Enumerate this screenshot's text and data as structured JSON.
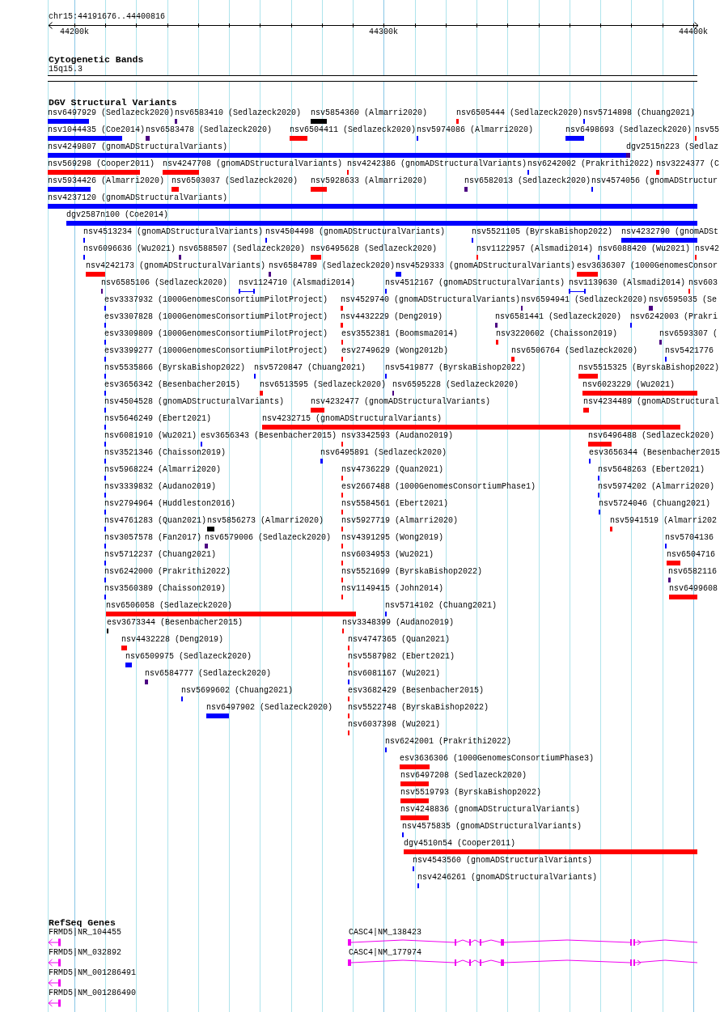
{
  "ruler": {
    "region": "chr15:44191676..44400816",
    "ticks": [
      "44200k",
      "44300k",
      "44400k"
    ]
  },
  "bands": {
    "title": "Cytogenetic Bands",
    "features": [
      {
        "label": "15q15.3"
      }
    ]
  },
  "variants": {
    "title": "DGV Structural Variants",
    "rows": [
      {
        "features": [
          {
            "label": "nsv6497929 (Sedlazeck2020)",
            "kind": "bar",
            "color": "#0000ff"
          },
          {
            "label": "nsv6583410 (Sedlazeck2020)",
            "kind": "bar",
            "color": "#4b0082"
          },
          {
            "label": "nsv5854360 (Almarri2020)",
            "kind": "bar",
            "color": "#000000"
          },
          {
            "label": "nsv6505444 (Sedlazeck2020)",
            "kind": "bar",
            "color": "#ff0000"
          },
          {
            "label": "nsv5714898 (Chuang2021)",
            "kind": "bar",
            "color": "#0000ff"
          }
        ]
      },
      {
        "features": [
          {
            "label": "nsv1044435 (Coe2014)",
            "kind": "bar",
            "color": "#0000ff"
          },
          {
            "label": "nsv6583478 (Sedlazeck2020)",
            "kind": "bar",
            "color": "#4b0082"
          },
          {
            "label": "nsv6504411 (Sedlazeck2020)",
            "kind": "bar",
            "color": "#ff0000"
          },
          {
            "label": "nsv5974086 (Almarri2020)",
            "kind": "bar",
            "color": "#0000ff"
          },
          {
            "label": "nsv6498693 (Sedlazeck2020)",
            "kind": "bar",
            "color": "#0000ff"
          },
          {
            "label": "nsv55",
            "kind": "bar",
            "color": "#ff0000"
          }
        ]
      },
      {
        "features": [
          {
            "label": "nsv4249807 (gnomADStructuralVariants)",
            "kind": "bar",
            "color": "#0000ff"
          },
          {
            "label": "dgv2515n223 (Sedlaz",
            "kind": "bar",
            "color": "#4b0082"
          }
        ]
      },
      {
        "features": [
          {
            "label": "nsv569298 (Cooper2011)",
            "kind": "bar",
            "color": "#ff0000"
          },
          {
            "label": "nsv4247708 (gnomADStructuralVariants)",
            "kind": "bar",
            "color": "#ff0000"
          },
          {
            "label": "nsv4242386 (gnomADStructuralVariants)",
            "kind": "bar",
            "color": "#ff0000"
          },
          {
            "label": "nsv6242002 (Prakrithi2022)",
            "kind": "bar",
            "color": "#0000ff"
          },
          {
            "label": "nsv3224377 (C",
            "kind": "bar",
            "color": "#ff0000"
          }
        ]
      },
      {
        "features": [
          {
            "label": "nsv5934426 (Almarri2020)",
            "kind": "bar",
            "color": "#0000ff"
          },
          {
            "label": "nsv6503037 (Sedlazeck2020)",
            "kind": "bar",
            "color": "#ff0000"
          },
          {
            "label": "nsv5928633 (Almarri2020)",
            "kind": "bar",
            "color": "#ff0000"
          },
          {
            "label": "nsv6582013 (Sedlazeck2020)",
            "kind": "bar",
            "color": "#4b0082"
          },
          {
            "label": "nsv4574056 (gnomADStructur",
            "kind": "bar",
            "color": "#0000ff"
          }
        ]
      },
      {
        "features": [
          {
            "label": "nsv4237120 (gnomADStructuralVariants)",
            "kind": "bar",
            "color": "#0000ff"
          }
        ]
      },
      {
        "features": [
          {
            "label": "dgv2587n100 (Coe2014)",
            "kind": "bar",
            "color": "#0000ff"
          }
        ]
      },
      {
        "features": [
          {
            "label": "nsv4513234 (gnomADStructuralVariants)",
            "kind": "bar",
            "color": "#0000ff"
          },
          {
            "label": "nsv4504498 (gnomADStructuralVariants)",
            "kind": "bar",
            "color": "#0000ff"
          },
          {
            "label": "nsv5521105 (ByrskaBishop2022)",
            "kind": "bar",
            "color": "#0000ff"
          },
          {
            "label": "nsv4232790 (gnomADSt",
            "kind": "bar",
            "color": "#0000ff"
          }
        ]
      },
      {
        "features": [
          {
            "label": "nsv6096636 (Wu2021)",
            "kind": "bar",
            "color": "#0000ff"
          },
          {
            "label": "nsv6588507 (Sedlazeck2020)",
            "kind": "bar",
            "color": "#4b0082"
          },
          {
            "label": "nsv6495628 (Sedlazeck2020)",
            "kind": "bar",
            "color": "#ff0000"
          },
          {
            "label": "nsv1122957 (Alsmadi2014)",
            "kind": "bar",
            "color": "#ff0000"
          },
          {
            "label": "nsv6088420 (Wu2021)",
            "kind": "bar",
            "color": "#0000ff"
          },
          {
            "label": "nsv42",
            "kind": "bar",
            "color": "#ff0000"
          }
        ]
      },
      {
        "features": [
          {
            "label": "nsv4242173 (gnomADStructuralVariants)",
            "kind": "bar",
            "color": "#ff0000"
          },
          {
            "label": "nsv6584789 (Sedlazeck2020)",
            "kind": "bar",
            "color": "#4b0082"
          },
          {
            "label": "nsv4529333 (gnomADStructuralVariants)",
            "kind": "bar",
            "color": "#0000ff"
          },
          {
            "label": "esv3636307 (1000GenomesConsor",
            "kind": "bar",
            "color": "#ff0000"
          }
        ]
      },
      {
        "features": [
          {
            "label": "nsv6585106 (Sedlazeck2020)",
            "kind": "bar",
            "color": "#4b0082"
          },
          {
            "label": "nsv1124710 (Alsmadi2014)",
            "kind": "span",
            "color": "#0000ff"
          },
          {
            "label": "nsv4512167 (gnomADStructuralVariants)",
            "kind": "bar",
            "color": "#0000ff"
          },
          {
            "label": "nsv1139630 (Alsmadi2014)",
            "kind": "span",
            "color": "#0000ff"
          },
          {
            "label": "nsv603",
            "kind": "bar",
            "color": "#ff0000"
          }
        ]
      },
      {
        "features": [
          {
            "label": "esv3337932 (1000GenomesConsortiumPilotProject)",
            "kind": "bar",
            "color": "#0000ff"
          },
          {
            "label": "nsv4529740 (gnomADStructuralVariants)",
            "kind": "bar",
            "color": "#ff0000"
          },
          {
            "label": "nsv6594941 (Sedlazeck2020)",
            "kind": "bar",
            "color": "#4b0082"
          },
          {
            "label": "nsv6595035 (Se",
            "kind": "bar",
            "color": "#4b0082"
          }
        ]
      },
      {
        "features": [
          {
            "label": "esv3307828 (1000GenomesConsortiumPilotProject)",
            "kind": "bar",
            "color": "#0000ff"
          },
          {
            "label": "nsv4432229 (Deng2019)",
            "kind": "bar",
            "color": "#ff0000"
          },
          {
            "label": "nsv6581441 (Sedlazeck2020)",
            "kind": "bar",
            "color": "#4b0082"
          },
          {
            "label": "nsv6242003 (Prakri",
            "kind": "bar",
            "color": "#0000ff"
          }
        ]
      },
      {
        "features": [
          {
            "label": "esv3309809 (1000GenomesConsortiumPilotProject)",
            "kind": "bar",
            "color": "#0000ff"
          },
          {
            "label": "esv3552381 (Boomsma2014)",
            "kind": "bar",
            "color": "#ff0000"
          },
          {
            "label": "nsv3220602 (Chaisson2019)",
            "kind": "bar",
            "color": "#ff0000"
          },
          {
            "label": "nsv6593307 (",
            "kind": "bar",
            "color": "#4b0082"
          }
        ]
      },
      {
        "features": [
          {
            "label": "esv3399277 (1000GenomesConsortiumPilotProject)",
            "kind": "bar",
            "color": "#0000ff"
          },
          {
            "label": "esv2749629 (Wong2012b)",
            "kind": "bar",
            "color": "#ff0000"
          },
          {
            "label": "nsv6506764 (Sedlazeck2020)",
            "kind": "bar",
            "color": "#ff0000"
          },
          {
            "label": "nsv5421776",
            "kind": "bar",
            "color": "#0000ff"
          }
        ]
      },
      {
        "features": [
          {
            "label": "nsv5535866 (ByrskaBishop2022)",
            "kind": "bar",
            "color": "#0000ff"
          },
          {
            "label": "nsv5720847 (Chuang2021)",
            "kind": "bar",
            "color": "#0000ff"
          },
          {
            "label": "nsv5419877 (ByrskaBishop2022)",
            "kind": "bar",
            "color": "#0000ff"
          },
          {
            "label": "nsv5515325 (ByrskaBishop2022)",
            "kind": "bar",
            "color": "#ff0000"
          }
        ]
      },
      {
        "features": [
          {
            "label": "esv3656342 (Besenbacher2015)",
            "kind": "bar",
            "color": "#0000ff"
          },
          {
            "label": "nsv6513595 (Sedlazeck2020)",
            "kind": "bar",
            "color": "#ff0000"
          },
          {
            "label": "nsv6595228 (Sedlazeck2020)",
            "kind": "bar",
            "color": "#4b0082"
          },
          {
            "label": "nsv6023229 (Wu2021)",
            "kind": "bar",
            "color": "#ff0000"
          }
        ]
      },
      {
        "features": [
          {
            "label": "nsv4504528 (gnomADStructuralVariants)",
            "kind": "bar",
            "color": "#0000ff"
          },
          {
            "label": "nsv4232477 (gnomADStructuralVariants)",
            "kind": "bar",
            "color": "#ff0000"
          },
          {
            "label": "nsv4234489 (gnomADStructural",
            "kind": "bar",
            "color": "#ff0000"
          }
        ]
      },
      {
        "features": [
          {
            "label": "nsv5646249 (Ebert2021)",
            "kind": "bar",
            "color": "#0000ff"
          },
          {
            "label": "nsv4232715 (gnomADStructuralVariants)",
            "kind": "bar",
            "color": "#ff0000"
          }
        ]
      },
      {
        "features": [
          {
            "label": "nsv6081910 (Wu2021)",
            "kind": "bar",
            "color": "#0000ff"
          },
          {
            "label": "esv3656343 (Besenbacher2015)",
            "kind": "bar",
            "color": "#0000ff"
          },
          {
            "label": "nsv3342593 (Audano2019)",
            "kind": "bar",
            "color": "#ff0000"
          },
          {
            "label": "nsv6496488 (Sedlazeck2020)",
            "kind": "bar",
            "color": "#ff0000"
          }
        ]
      },
      {
        "features": [
          {
            "label": "nsv3521346 (Chaisson2019)",
            "kind": "bar",
            "color": "#0000ff"
          },
          {
            "label": "nsv6495891 (Sedlazeck2020)",
            "kind": "bar",
            "color": "#0000ff"
          },
          {
            "label": "esv3656344 (Besenbacher2015",
            "kind": "bar",
            "color": "#0000ff"
          }
        ]
      },
      {
        "features": [
          {
            "label": "nsv5968224 (Almarri2020)",
            "kind": "bar",
            "color": "#0000ff"
          },
          {
            "label": "nsv4736229 (Quan2021)",
            "kind": "bar",
            "color": "#ff0000"
          },
          {
            "label": "nsv5648263 (Ebert2021)",
            "kind": "bar",
            "color": "#0000ff"
          }
        ]
      },
      {
        "features": [
          {
            "label": "nsv3339832 (Audano2019)",
            "kind": "bar",
            "color": "#0000ff"
          },
          {
            "label": "esv2667488 (1000GenomesConsortiumPhase1)",
            "kind": "bar",
            "color": "#ff0000"
          },
          {
            "label": "nsv5974202 (Almarri2020)",
            "kind": "bar",
            "color": "#0000ff"
          }
        ]
      },
      {
        "features": [
          {
            "label": "nsv2794964 (Huddleston2016)",
            "kind": "bar",
            "color": "#0000ff"
          },
          {
            "label": "nsv5584561 (Ebert2021)",
            "kind": "bar",
            "color": "#ff0000"
          },
          {
            "label": "nsv5724046 (Chuang2021)",
            "kind": "bar",
            "color": "#0000ff"
          }
        ]
      },
      {
        "features": [
          {
            "label": "nsv4761283 (Quan2021)",
            "kind": "bar",
            "color": "#0000ff"
          },
          {
            "label": "nsv5856273 (Almarri2020)",
            "kind": "bar",
            "color": "#000000"
          },
          {
            "label": "nsv5927719 (Almarri2020)",
            "kind": "bar",
            "color": "#ff0000"
          },
          {
            "label": "nsv5941519 (Almarri202",
            "kind": "bar",
            "color": "#ff0000"
          }
        ]
      },
      {
        "features": [
          {
            "label": "nsv3057578 (Fan2017)",
            "kind": "bar",
            "color": "#0000ff"
          },
          {
            "label": "nsv6579006 (Sedlazeck2020)",
            "kind": "bar",
            "color": "#4b0082"
          },
          {
            "label": "nsv4391295 (Wong2019)",
            "kind": "bar",
            "color": "#ff0000"
          },
          {
            "label": "nsv5704136",
            "kind": "bar",
            "color": "#0000ff"
          }
        ]
      },
      {
        "features": [
          {
            "label": "nsv5712237 (Chuang2021)",
            "kind": "bar",
            "color": "#0000ff"
          },
          {
            "label": "nsv6034953 (Wu2021)",
            "kind": "bar",
            "color": "#ff0000"
          },
          {
            "label": "nsv6504716",
            "kind": "bar",
            "color": "#ff0000"
          }
        ]
      },
      {
        "features": [
          {
            "label": "nsv6242000 (Prakrithi2022)",
            "kind": "bar",
            "color": "#0000ff"
          },
          {
            "label": "nsv5521699 (ByrskaBishop2022)",
            "kind": "bar",
            "color": "#ff0000"
          },
          {
            "label": "nsv6582116",
            "kind": "bar",
            "color": "#4b0082"
          }
        ]
      },
      {
        "features": [
          {
            "label": "nsv3560389 (Chaisson2019)",
            "kind": "bar",
            "color": "#0000ff"
          },
          {
            "label": "nsv1149415 (John2014)",
            "kind": "bar",
            "color": "#ff0000"
          },
          {
            "label": "nsv6499608",
            "kind": "bar",
            "color": "#ff0000"
          }
        ]
      },
      {
        "features": [
          {
            "label": "nsv6506058 (Sedlazeck2020)",
            "kind": "bar",
            "color": "#ff0000"
          },
          {
            "label": "nsv5714102 (Chuang2021)",
            "kind": "bar",
            "color": "#0000ff"
          }
        ]
      },
      {
        "features": [
          {
            "label": "esv3673344 (Besenbacher2015)",
            "kind": "bar",
            "color": "#000000"
          },
          {
            "label": "nsv3348399 (Audano2019)",
            "kind": "bar",
            "color": "#ff0000"
          }
        ]
      },
      {
        "features": [
          {
            "label": "nsv4432228 (Deng2019)",
            "kind": "bar",
            "color": "#ff0000"
          },
          {
            "label": "nsv4747365 (Quan2021)",
            "kind": "bar",
            "color": "#ff0000"
          }
        ]
      },
      {
        "features": [
          {
            "label": "nsv6509975 (Sedlazeck2020)",
            "kind": "bar",
            "color": "#0000ff"
          },
          {
            "label": "nsv5587982 (Ebert2021)",
            "kind": "bar",
            "color": "#ff0000"
          }
        ]
      },
      {
        "features": [
          {
            "label": "nsv6584777 (Sedlazeck2020)",
            "kind": "bar",
            "color": "#4b0082"
          },
          {
            "label": "nsv6081167 (Wu2021)",
            "kind": "bar",
            "color": "#0000ff"
          }
        ]
      },
      {
        "features": [
          {
            "label": "nsv5699602 (Chuang2021)",
            "kind": "bar",
            "color": "#0000ff"
          },
          {
            "label": "esv3682429 (Besenbacher2015)",
            "kind": "bar",
            "color": "#ff0000"
          }
        ]
      },
      {
        "features": [
          {
            "label": "nsv6497902 (Sedlazeck2020)",
            "kind": "bar",
            "color": "#0000ff"
          },
          {
            "label": "nsv5522748 (ByrskaBishop2022)",
            "kind": "bar",
            "color": "#ff0000"
          }
        ]
      },
      {
        "features": [
          {
            "label": "nsv6037398 (Wu2021)",
            "kind": "bar",
            "color": "#ff0000"
          }
        ]
      },
      {
        "features": [
          {
            "label": "nsv6242001 (Prakrithi2022)",
            "kind": "bar",
            "color": "#0000ff"
          }
        ]
      },
      {
        "features": [
          {
            "label": "esv3636306 (1000GenomesConsortiumPhase3)",
            "kind": "bar",
            "color": "#ff0000"
          }
        ]
      },
      {
        "features": [
          {
            "label": "nsv6497208 (Sedlazeck2020)",
            "kind": "bar",
            "color": "#ff0000"
          }
        ]
      },
      {
        "features": [
          {
            "label": "nsv5519793 (ByrskaBishop2022)",
            "kind": "bar",
            "color": "#ff0000"
          }
        ]
      },
      {
        "features": [
          {
            "label": "nsv4248836 (gnomADStructuralVariants)",
            "kind": "bar",
            "color": "#ff0000"
          }
        ]
      },
      {
        "features": [
          {
            "label": "nsv4575835 (gnomADStructuralVariants)",
            "kind": "bar",
            "color": "#0000ff"
          }
        ]
      },
      {
        "features": [
          {
            "label": "dgv4510n54 (Cooper2011)",
            "kind": "bar",
            "color": "#ff0000"
          }
        ]
      },
      {
        "features": [
          {
            "label": "nsv4543560 (gnomADStructuralVariants)",
            "kind": "bar",
            "color": "#0000ff"
          }
        ]
      },
      {
        "features": [
          {
            "label": "nsv4246261 (gnomADStructuralVariants)",
            "kind": "bar",
            "color": "#0000ff"
          }
        ]
      }
    ]
  },
  "genes": {
    "title": "RefSeq Genes",
    "rows": [
      {
        "features": [
          {
            "label": "FRMD5|NR_104455",
            "reverse_strand": true
          },
          {
            "label": "CASC4|NM_138423",
            "reverse_strand": false
          }
        ]
      },
      {
        "features": [
          {
            "label": "FRMD5|NM_032892",
            "reverse_strand": true
          },
          {
            "label": "CASC4|NM_177974",
            "reverse_strand": false
          }
        ]
      },
      {
        "features": [
          {
            "label": "FRMD5|NM_001286491",
            "reverse_strand": true
          }
        ]
      },
      {
        "features": [
          {
            "label": "FRMD5|NM_001286490",
            "reverse_strand": true
          }
        ]
      }
    ]
  }
}
